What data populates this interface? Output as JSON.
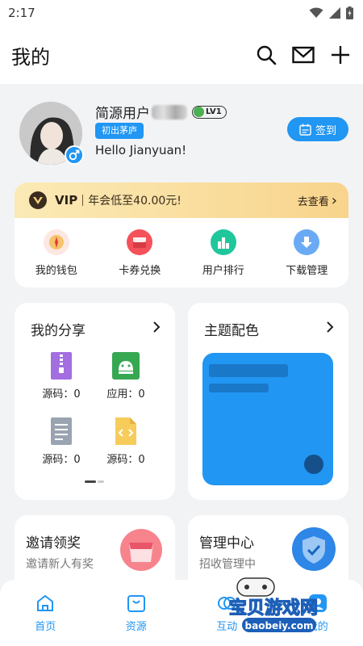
{
  "status": {
    "time": "2:17"
  },
  "header": {
    "title": "我的"
  },
  "profile": {
    "username": "简源用户",
    "level": "LV1",
    "title_tag": "初出茅庐",
    "greeting": "Hello Jianyuan!",
    "checkin_label": "签到"
  },
  "vip": {
    "label": "VIP",
    "desc": "年会低至40.00元!",
    "link": "去查看",
    "link_arrow": "›"
  },
  "quick": [
    {
      "label": "我的钱包",
      "icon": "wallet-icon"
    },
    {
      "label": "卡券兑换",
      "icon": "coupon-icon"
    },
    {
      "label": "用户排行",
      "icon": "ranking-icon"
    },
    {
      "label": "下载管理",
      "icon": "download-icon"
    }
  ],
  "share": {
    "title": "我的分享",
    "items": [
      {
        "label": "源码：0",
        "icon": "zip-file-icon"
      },
      {
        "label": "应用：0",
        "icon": "android-app-icon"
      },
      {
        "label": "源码：0",
        "icon": "text-file-icon"
      },
      {
        "label": "源码：0",
        "icon": "code-file-icon"
      }
    ]
  },
  "theme": {
    "title": "主题配色"
  },
  "invite": {
    "title": "邀请领奖",
    "subtitle": "邀请新人有奖"
  },
  "admin": {
    "title": "管理中心",
    "subtitle": "招收管理中"
  },
  "nav": [
    {
      "label": "首页",
      "icon": "home-icon"
    },
    {
      "label": "资源",
      "icon": "resource-bag-icon"
    },
    {
      "label": "互动",
      "icon": "interaction-icon"
    },
    {
      "label": "我的",
      "icon": "profile-icon"
    }
  ],
  "watermark": {
    "text": "宝贝游戏网",
    "url": "baobeiy.com"
  },
  "colors": {
    "accent": "#2196f3",
    "vip_gold": "#f8d48c",
    "background": "#f2f3f5"
  }
}
